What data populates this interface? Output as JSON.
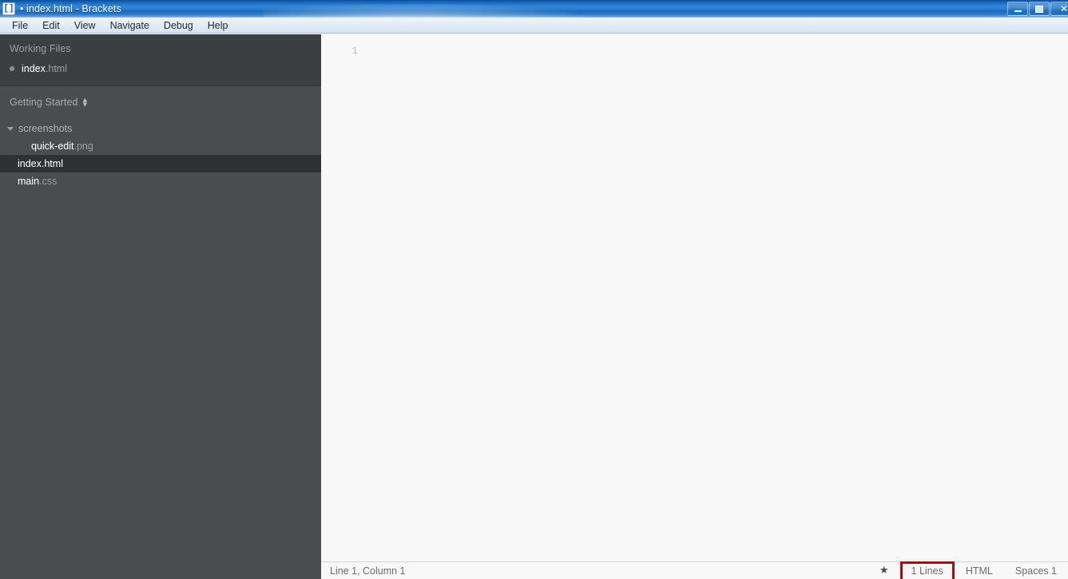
{
  "window": {
    "icon": "brackets-icon",
    "title": "• index.html - Brackets",
    "buttons": {
      "minimize": "minimize-icon",
      "maximize": "restore-icon",
      "close": "✕"
    }
  },
  "menubar": {
    "items": [
      {
        "label": "File"
      },
      {
        "label": "Edit"
      },
      {
        "label": "View"
      },
      {
        "label": "Navigate"
      },
      {
        "label": "Debug"
      },
      {
        "label": "Help"
      }
    ]
  },
  "sidebar": {
    "working_files": {
      "title": "Working Files",
      "items": [
        {
          "name": "index",
          "ext": ".html",
          "dirty": true
        }
      ]
    },
    "project": {
      "title": "Getting Started",
      "tree": [
        {
          "type": "folder",
          "label": "screenshots",
          "expanded": true
        },
        {
          "type": "file",
          "name": "quick-edit",
          "ext": ".png",
          "indented": true,
          "selected": false
        },
        {
          "type": "file",
          "name": "index.html",
          "ext": "",
          "indented": false,
          "selected": true
        },
        {
          "type": "file",
          "name": "main",
          "ext": ".css",
          "indented": false,
          "selected": false
        }
      ]
    }
  },
  "editor": {
    "line_numbers": [
      "1"
    ],
    "lines": [
      ""
    ]
  },
  "statusbar": {
    "cursor": "Line 1, Column 1",
    "star_icon": "★",
    "lines": "1 Lines",
    "language": "HTML",
    "indent": "Spaces 1",
    "highlight_color": "#a01010"
  }
}
